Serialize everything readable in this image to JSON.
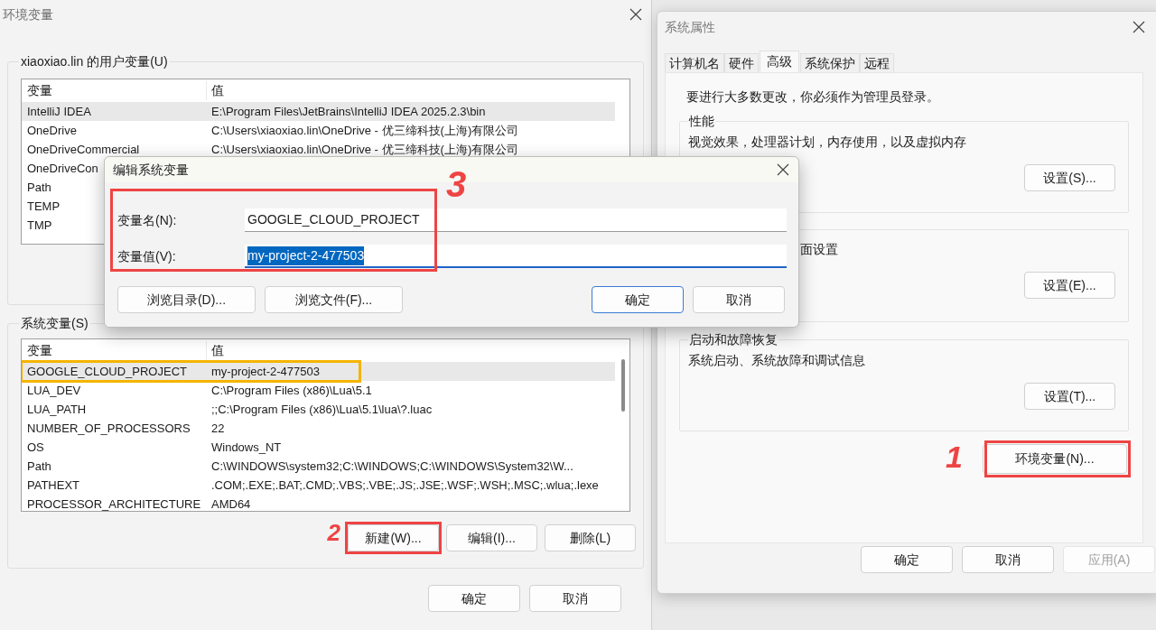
{
  "env_window": {
    "title": "环境变量",
    "user_vars": {
      "label": "xiaoxiao.lin 的用户变量(U)",
      "columns": [
        "变量",
        "值"
      ],
      "rows": [
        {
          "name": "IntelliJ IDEA",
          "value": "E:\\Program Files\\JetBrains\\IntelliJ IDEA 2025.2.3\\bin",
          "selected": true
        },
        {
          "name": "OneDrive",
          "value": "C:\\Users\\xiaoxiao.lin\\OneDrive - 优三缔科技(上海)有限公司",
          "selected": false
        },
        {
          "name": "OneDriveCommercial",
          "value": "C:\\Users\\xiaoxiao.lin\\OneDrive - 优三缔科技(上海)有限公司",
          "selected": false
        },
        {
          "name": "OneDriveCon",
          "selected": false
        },
        {
          "name": "Path",
          "selected": false
        },
        {
          "name": "TEMP",
          "selected": false
        },
        {
          "name": "TMP",
          "selected": false
        }
      ]
    },
    "system_vars": {
      "label": "系统变量(S)",
      "columns": [
        "变量",
        "值"
      ],
      "rows": [
        {
          "name": "GOOGLE_CLOUD_PROJECT",
          "value": "my-project-2-477503",
          "selected": true,
          "highlight": {
            "color": "#f5b400"
          }
        },
        {
          "name": "LUA_DEV",
          "value": "C:\\Program Files (x86)\\Lua\\5.1",
          "selected": false
        },
        {
          "name": "LUA_PATH",
          "value": ";;C:\\Program Files (x86)\\Lua\\5.1\\lua\\?.luac",
          "selected": false
        },
        {
          "name": "NUMBER_OF_PROCESSORS",
          "value": "22",
          "selected": false
        },
        {
          "name": "OS",
          "value": "Windows_NT",
          "selected": false
        },
        {
          "name": "Path",
          "value": "C:\\WINDOWS\\system32;C:\\WINDOWS;C:\\WINDOWS\\System32\\W...",
          "selected": false
        },
        {
          "name": "PATHEXT",
          "value": ".COM;.EXE;.BAT;.CMD;.VBS;.VBE;.JS;.JSE;.WSF;.WSH;.MSC;.wlua;.lexe",
          "selected": false
        },
        {
          "name": "PROCESSOR_ARCHITECTURE",
          "value": "AMD64",
          "selected": false
        }
      ],
      "buttons": [
        {
          "label": "新建(W)...",
          "highlight": {
            "color": "#ee4444",
            "step": "2"
          }
        },
        {
          "label": "编辑(I)..."
        },
        {
          "label": "删除(L)"
        }
      ]
    },
    "buttons": [
      "确定",
      "取消"
    ]
  },
  "edit_dialog": {
    "title": "编辑系统变量",
    "fields": [
      {
        "label": "变量名(N):",
        "value": "GOOGLE_CLOUD_PROJECT",
        "focused": false
      },
      {
        "label": "变量值(V):",
        "value": "my-project-2-477503",
        "focused": true
      }
    ],
    "highlight": {
      "color": "#ee4444",
      "step": "3"
    },
    "buttons": [
      {
        "label": "浏览目录(D)...",
        "default": false
      },
      {
        "label": "浏览文件(F)...",
        "default": false
      },
      {
        "label": "确定",
        "default": true
      },
      {
        "label": "取消",
        "default": false
      }
    ]
  },
  "system_properties": {
    "title": "系统属性",
    "tabs": [
      {
        "label": "计算机名",
        "selected": false
      },
      {
        "label": "硬件",
        "selected": false
      },
      {
        "label": "高级",
        "selected": true
      },
      {
        "label": "系统保护",
        "selected": false
      },
      {
        "label": "远程",
        "selected": false
      }
    ],
    "notice": "要进行大多数更改，你必须作为管理员登录。",
    "groups": [
      {
        "title": "性能",
        "description": "视觉效果，处理器计划，内存使用，以及虚拟内存",
        "button": "设置(S)..."
      },
      {
        "description": "面设置",
        "button": "设置(E)..."
      },
      {
        "title": "启动和故障恢复",
        "description": "系统启动、系统故障和调试信息",
        "button": "设置(T)..."
      }
    ],
    "env_button": {
      "label": "环境变量(N)...",
      "highlight": {
        "color": "#ee4444",
        "step": "1"
      }
    },
    "buttons": [
      {
        "label": "确定",
        "disabled": false
      },
      {
        "label": "取消",
        "disabled": false
      },
      {
        "label": "应用(A)",
        "disabled": true
      }
    ]
  }
}
